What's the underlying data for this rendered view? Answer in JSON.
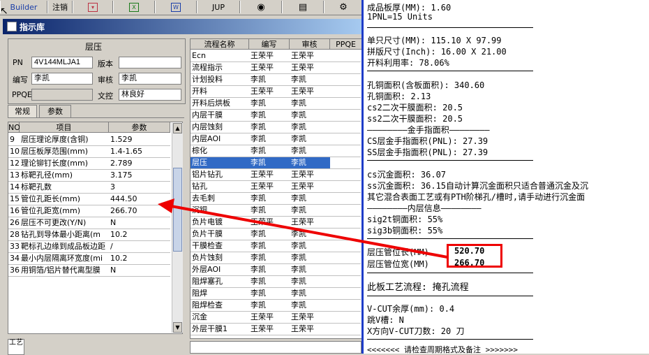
{
  "toolbar": {
    "builder": "Builder",
    "logout": "注销",
    "jup": "JUP",
    "icons": [
      "dropdown-icon",
      "excel-icon",
      "word-icon",
      "jup",
      "eye-icon",
      "database-icon",
      "tools-icon"
    ]
  },
  "window": {
    "title": "指示库"
  },
  "layer_group": {
    "title": "层压",
    "pn_label": "PN",
    "pn_value": "4V144MLJA1",
    "version_label": "版本",
    "version_value": "",
    "author_label": "编写",
    "author_value": "李凯",
    "reviewer_label": "审核",
    "reviewer_value": "李凯",
    "ppqe_label": "PPQE",
    "ppqe_value": "",
    "control_label": "文控",
    "control_value": "林良好"
  },
  "tabs": [
    "常规",
    "参数"
  ],
  "param_grid": {
    "headers": [
      "NO",
      "项目",
      "参数"
    ],
    "rows": [
      [
        "9",
        "层压理论厚度(含铜)",
        "1.529"
      ],
      [
        "10",
        "层压板厚范围(mm)",
        "1.4-1.65"
      ],
      [
        "12",
        "理论铆钉长度(mm)",
        "2.789"
      ],
      [
        "13",
        "标靶孔径(mm)",
        "3.175"
      ],
      [
        "14",
        "标靶孔数",
        "3"
      ],
      [
        "15",
        "管位孔距长(mm)",
        "444.50"
      ],
      [
        "16",
        "管位孔距宽(mm)",
        "266.70"
      ],
      [
        "26",
        "层压不可更改(Y/N)",
        "N"
      ],
      [
        "28",
        "钻孔到导体最小距离(m",
        "10.2"
      ],
      [
        "33",
        "靶标孔边缘到成品板边距",
        "/"
      ],
      [
        "34",
        "最小内层隔离环宽度(mi",
        "10.2"
      ],
      [
        "36",
        "用铜箔/铝片替代离型膜",
        "N"
      ]
    ],
    "footer_label": "工艺"
  },
  "flow_grid": {
    "headers": [
      "流程名称",
      "编写",
      "审核",
      "PPQE"
    ],
    "rows": [
      [
        "Ecn",
        "王荣平",
        "王荣平"
      ],
      [
        "流程指示",
        "王荣平",
        "王荣平"
      ],
      [
        "计划投料",
        "李凯",
        "李凯"
      ],
      [
        "开料",
        "王荣平",
        "王荣平"
      ],
      [
        "开料后烘板",
        "李凯",
        "李凯"
      ],
      [
        "内层干膜",
        "李凯",
        "李凯"
      ],
      [
        "内层蚀刻",
        "李凯",
        "李凯"
      ],
      [
        "内层AOI",
        "李凯",
        "李凯"
      ],
      [
        "棕化",
        "李凯",
        "李凯"
      ],
      [
        "层压",
        "李凯",
        "李凯"
      ],
      [
        "铝片钻孔",
        "王荣平",
        "王荣平"
      ],
      [
        "钻孔",
        "王荣平",
        "王荣平"
      ],
      [
        "去毛刺",
        "李凯",
        "李凯"
      ],
      [
        "沉铜",
        "李凯",
        "李凯"
      ],
      [
        "负片电镀",
        "王荣平",
        "王荣平"
      ],
      [
        "负片干膜",
        "李凯",
        "李凯"
      ],
      [
        "干膜检查",
        "李凯",
        "李凯"
      ],
      [
        "负片蚀刻",
        "李凯",
        "李凯"
      ],
      [
        "外层AOI",
        "李凯",
        "李凯"
      ],
      [
        "阻焊塞孔",
        "李凯",
        "李凯"
      ],
      [
        "阻焊",
        "李凯",
        "李凯"
      ],
      [
        "阻焊检查",
        "李凯",
        "李凯"
      ],
      [
        "沉金",
        "王荣平",
        "王荣平"
      ],
      [
        "外层干膜1",
        "王荣平",
        "王荣平"
      ]
    ],
    "selected_index": 9
  },
  "right_panel": {
    "lines": [
      "成品板厚(MM): 1.60",
      "1PNL=15 Units",
      "单只尺寸(MM): 115.10 X 97.99",
      "拼版尺寸(Inch): 16.00 X 21.00",
      "开料利用率: 78.06%",
      "孔铜面积(含板面积): 340.60",
      "孔铜面积: 2.13",
      "cs2二次干膜面积: 20.5",
      "ss2二次干膜面积: 20.5",
      "————————金手指面积————————",
      "CS层金手指面积(PNL): 27.39",
      "SS层金手指面积(PNL): 27.39",
      "cs沉金面积: 36.07",
      "ss沉金面积: 36.15自动计算沉金面积只适合普通沉金及沉",
      "其它混合表面工艺或有PTH阶梯孔/槽时,请手动进行沉金面",
      "————————内层信息————————",
      "sig2t铜面积: 55%",
      "sig3b铜面积: 55%",
      "层压管位长(MM)",
      "层压管位宽(MM)",
      "此板工艺流程: 掩孔流程",
      "V-CUT余厚(mm): 0.4",
      "跳V槽: N",
      "X方向V-CUT刀数: 20 刀",
      "<<<<<<< 请检查周期格式及备注 >>>>>>>"
    ],
    "highlight_values": [
      "520.70",
      "266.70"
    ],
    "highlight_color": "#e00000"
  }
}
